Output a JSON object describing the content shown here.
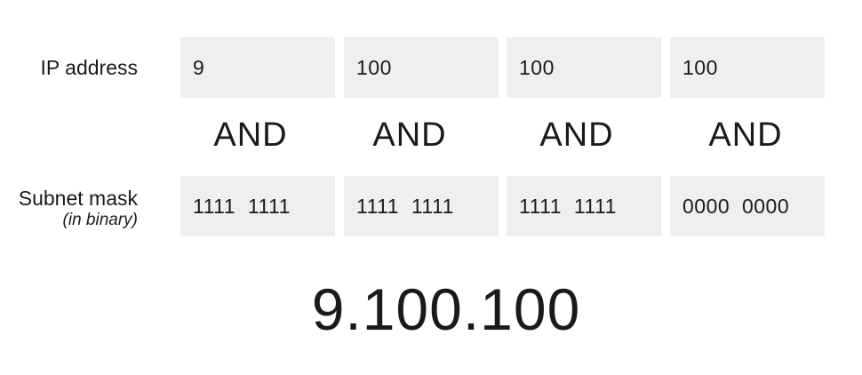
{
  "ip_row": {
    "label": "IP address",
    "octets": [
      "9",
      "100",
      "100",
      "100"
    ]
  },
  "operator": {
    "labels": [
      "AND",
      "AND",
      "AND",
      "AND"
    ]
  },
  "mask_row": {
    "label": "Subnet mask",
    "sublabel": "(in binary)",
    "octets": [
      "1111  1111",
      "1111  1111",
      "1111  1111",
      "0000  0000"
    ]
  },
  "result": {
    "value": "9.100.100"
  }
}
